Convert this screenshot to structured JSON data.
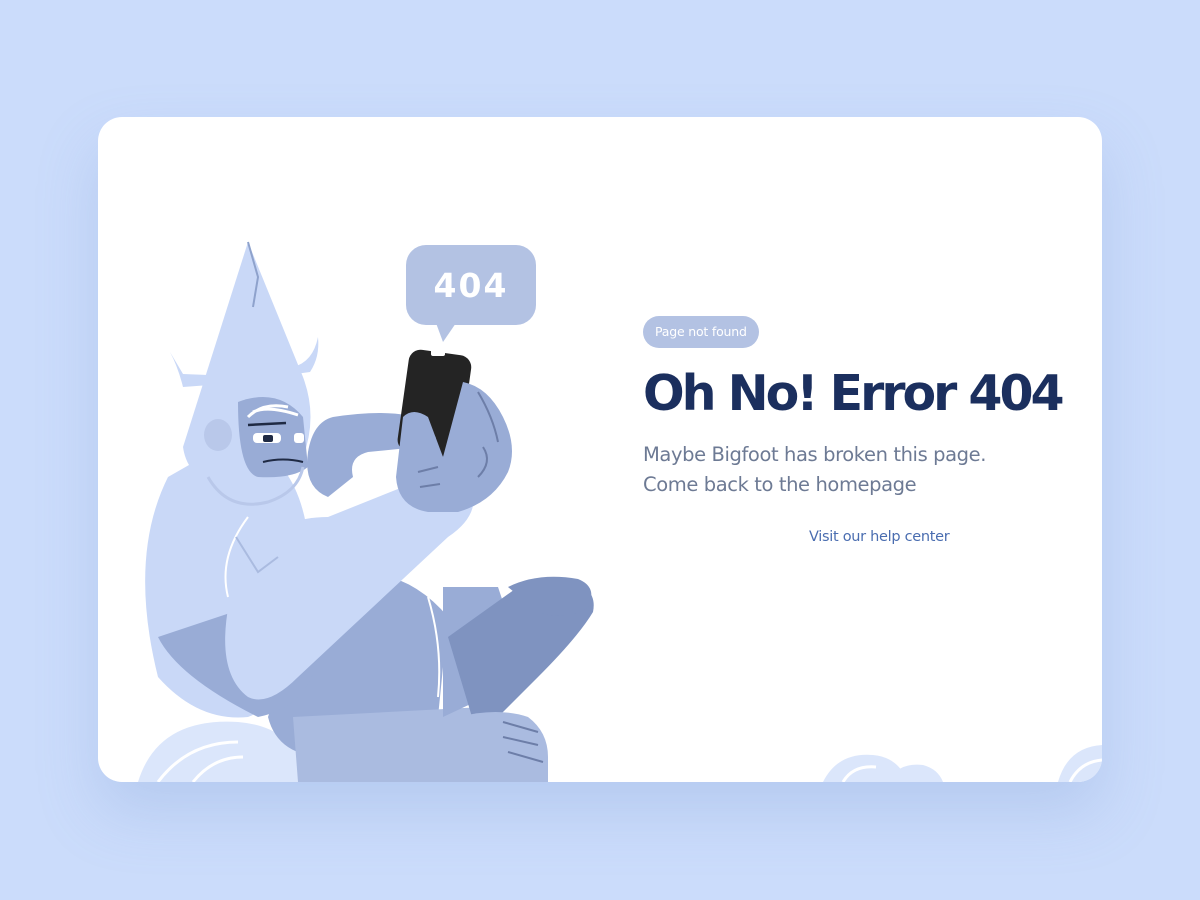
{
  "illustration": {
    "speech_bubble_text": "404",
    "subject": "bigfoot-holding-phone"
  },
  "content": {
    "badge": "Page not found",
    "title": "Oh No! Error 404",
    "description_line1": "Maybe Bigfoot has broken this page.",
    "description_line2": "Come back to the homepage",
    "help_link": "Visit our help center"
  },
  "colors": {
    "page_background": "#cbdcfb",
    "card": "#ffffff",
    "title": "#1b2f5e",
    "body_text": "#6d7a94",
    "link": "#4a6db0",
    "badge": "#b3c2e3",
    "bigfoot_light": "#c9d8f7",
    "bigfoot_mid": "#99acd6",
    "bigfoot_dark": "#7f93c0",
    "phone": "#242424"
  }
}
